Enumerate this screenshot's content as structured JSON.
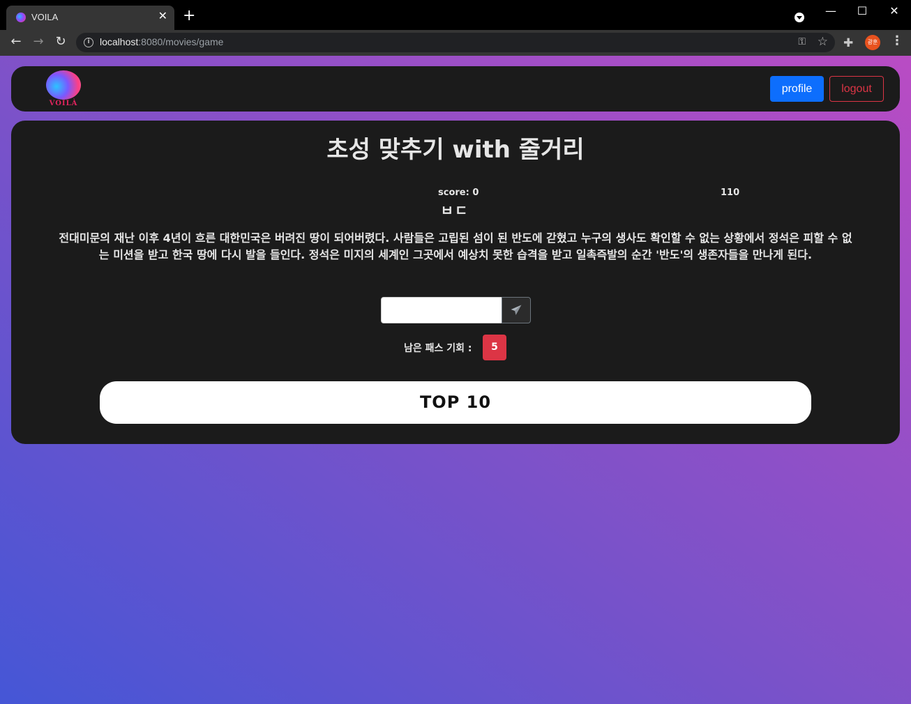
{
  "browser": {
    "tab_title": "VOILA",
    "tab_close": "✕",
    "new_tab": "+",
    "url_host": "localhost",
    "url_path": ":8080/movies/game",
    "avatar_text": "광훈",
    "window_controls": {
      "minimize": "—",
      "maximize": "☐",
      "close": "✕"
    }
  },
  "navbar": {
    "logo_text": "VOILÀ",
    "profile_label": "profile",
    "logout_label": "logout"
  },
  "game": {
    "title": "초성 맞추기 with 줄거리",
    "score_label": "score: 0",
    "timer": "110",
    "hint": "ㅂㄷ",
    "plot": "전대미문의 재난 이후 4년이 흐른 대한민국은 버려진 땅이 되어버렸다. 사람들은 고립된 섬이 된 반도에 갇혔고 누구의 생사도 확인할 수 없는 상황에서 정석은 피할 수 없는 미션을 받고 한국 땅에 다시 발을 들인다. 정석은 미지의 세계인 그곳에서 예상치 못한 습격을 받고 일촉즉발의 순간 '반도'의 생존자들을 만나게 된다.",
    "answer_value": "",
    "pass_label": "남은 패스 기회 :",
    "pass_count": "5",
    "top10_label": "TOP 10"
  },
  "colors": {
    "primary": "#0d6efd",
    "danger": "#dc3545",
    "card": "#1b1b1b",
    "gradient_start": "#4556d6",
    "gradient_end": "#b94cc4"
  }
}
